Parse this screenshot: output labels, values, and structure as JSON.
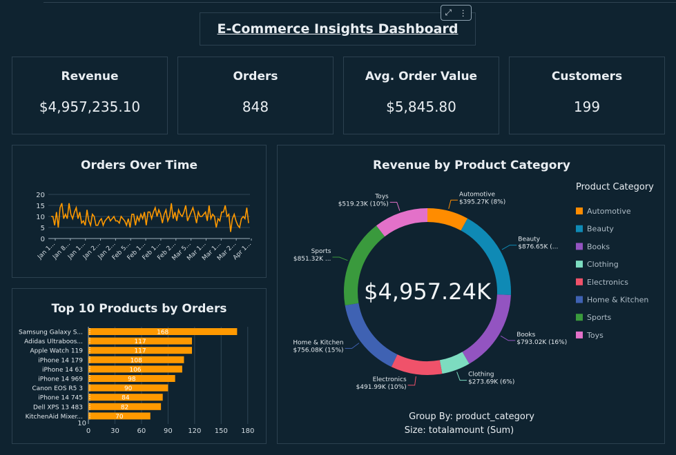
{
  "dashboard": {
    "title": "E-Commerce Insights Dashboard"
  },
  "kpis": [
    {
      "title": "Revenue",
      "value": "$4,957,235.10"
    },
    {
      "title": "Orders",
      "value": "848"
    },
    {
      "title": "Avg. Order Value",
      "value": "$5,845.80"
    },
    {
      "title": "Customers",
      "value": "199"
    }
  ],
  "colors": {
    "background": "#0f2330",
    "line": "#ff9900",
    "bar": "#ff9900",
    "border": "#2c4150"
  },
  "icons": {
    "expand": "expand-icon",
    "menu": "more-vertical-icon"
  },
  "orders_over_time": {
    "title": "Orders Over Time",
    "y_ticks": [
      "0",
      "5",
      "10",
      "15",
      "20"
    ],
    "x_ticks": [
      "Jan 1...",
      "Jan 8...",
      "Jan 1...",
      "Jan 2...",
      "Jan 2...",
      "Feb 5...",
      "Feb 1...",
      "Feb 1...",
      "Feb 2...",
      "Mar 5...",
      "Mar 1...",
      "Mar 1...",
      "Mar 2...",
      "Apr 1..."
    ]
  },
  "top_products": {
    "title": "Top 10 Products by Orders",
    "x_ticks": [
      "0",
      "30",
      "60",
      "90",
      "120",
      "150",
      "180"
    ],
    "y_bottom_tick": "10"
  },
  "revenue_by_category": {
    "title": "Revenue by Product Category",
    "center_label": "$4,957.24K",
    "legend_title": "Product Category",
    "group_by": "Group By: product_category",
    "size_by": "Size: totalamount (Sum)",
    "labels": [
      {
        "name": "Automotive",
        "value": "$395.27K (8%)"
      },
      {
        "name": "Beauty",
        "value": "$876.65K (..."
      },
      {
        "name": "Books",
        "value": "$793.02K (16%)"
      },
      {
        "name": "Clothing",
        "value": "$273.69K (6%)"
      },
      {
        "name": "Electronics",
        "value": "$491.99K (10%)"
      },
      {
        "name": "Home & Kitchen",
        "value": "$756.08K (15%)"
      },
      {
        "name": "Sports",
        "value": "$851.32K ..."
      },
      {
        "name": "Toys",
        "value": "$519.23K (10%)"
      }
    ]
  },
  "chart_data": [
    {
      "type": "line",
      "title": "Orders Over Time",
      "ylim": [
        0,
        20
      ],
      "x": [
        "Jan 1",
        "Apr 1"
      ],
      "series": [
        {
          "values": [
            10,
            10,
            6,
            12,
            5,
            14,
            16,
            9,
            11,
            9,
            16,
            11,
            9,
            12,
            14,
            9,
            12,
            7,
            8,
            6,
            13,
            8,
            6,
            11,
            10,
            6,
            6,
            8,
            9,
            6,
            8,
            9,
            10,
            8,
            9,
            10,
            8,
            8,
            7,
            10,
            9,
            8,
            6,
            9,
            5,
            11,
            11,
            6,
            10,
            8,
            11,
            9,
            12,
            6,
            12,
            12,
            9,
            12,
            14,
            10,
            13,
            11,
            7,
            11,
            13,
            8,
            10,
            16,
            9,
            12,
            8,
            13,
            11,
            10,
            12,
            15,
            8,
            10,
            12,
            14,
            11,
            7,
            12,
            10,
            10,
            11,
            12,
            8,
            15,
            9,
            11,
            10,
            5,
            9,
            8,
            12,
            12,
            15,
            10,
            11,
            3,
            9,
            11,
            8,
            6,
            5,
            9,
            10,
            9,
            14,
            7
          ]
        }
      ]
    },
    {
      "type": "bar",
      "title": "Top 10 Products by Orders",
      "orientation": "horizontal",
      "categories": [
        "Samsung Galaxy S...",
        "Adidas Ultraboos...",
        "Apple Watch 119",
        "iPhone 14 179",
        "iPhone 14 63",
        "iPhone 14 969",
        "Canon EOS R5 3",
        "iPhone 14 745",
        "Dell XPS 13 483",
        "KitchenAid Mixer..."
      ],
      "values": [
        168,
        117,
        117,
        108,
        106,
        98,
        90,
        84,
        82,
        70
      ],
      "xlim": [
        0,
        195
      ]
    },
    {
      "type": "pie",
      "title": "Revenue by Product Category",
      "donut": true,
      "categories": [
        "Automotive",
        "Beauty",
        "Books",
        "Clothing",
        "Electronics",
        "Home & Kitchen",
        "Sports",
        "Toys"
      ],
      "values": [
        395.27,
        876.65,
        793.02,
        273.69,
        491.99,
        756.08,
        851.32,
        519.23
      ],
      "colors": [
        "#ff8c00",
        "#0f8ab5",
        "#9354c1",
        "#7ddcc0",
        "#f0526a",
        "#3f62b3",
        "#3a9a3d",
        "#e371c9"
      ],
      "legend_position": "right"
    }
  ]
}
